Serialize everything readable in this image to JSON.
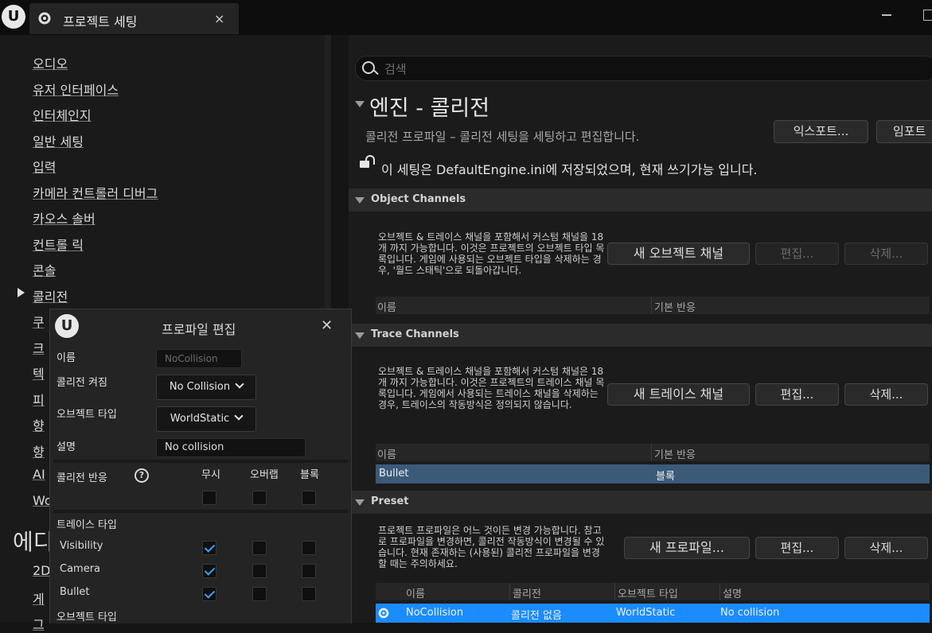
{
  "window": {
    "tab_title": "프로젝트 세팅",
    "close": "×"
  },
  "sidebar": {
    "items": [
      "오디오",
      "유저 인터페이스",
      "인터체인지",
      "일반 세팅",
      "입력",
      "카메라 컨트롤러 디버그",
      "카오스 솔버",
      "컨트롤 릭",
      "콘솔",
      "콜리전",
      "쿠",
      "크",
      "텍",
      "피",
      "향",
      "향",
      "AI",
      "Wo"
    ],
    "section_header": "에디",
    "tail_items": [
      "2D",
      "게",
      "그"
    ]
  },
  "search": {
    "placeholder": "검색"
  },
  "main": {
    "title": "엔진 - 콜리전",
    "description": "콜리전 프로파일 – 콜리전 세팅을 세팅하고 편집합니다.",
    "export_button": "익스포트...",
    "import_button": "임포트",
    "lock_text": "이 세팅은 DefaultEngine.ini에 저장되었으며, 현재 쓰기가능 입니다."
  },
  "object_channels": {
    "header": "Object Channels",
    "desc": "오브젝트 & 트레이스 채널을 포함해서 커스텀 채널을 18 개 까지 가능합니다. 이것은 프로젝트의 오브젝트 타입 목록입니다. 게임에 사용되는 오브젝트 타입을 삭제하는 경우, '월드 스태틱'으로 되돌아갑니다.",
    "new_button": "새 오브젝트 채널",
    "edit_button": "편집...",
    "delete_button": "삭제...",
    "columns": [
      "이름",
      "기본 반응"
    ]
  },
  "trace_channels": {
    "header": "Trace Channels",
    "desc": "오브젝트 & 트레이스 채널을 포함해서 커스텀 채널은 18 개 까지 가능합니다. 이것은 프로젝트의 트레이스 채널 목록입니다. 게임에서 사용되는 트레이스 채널을 삭제하는 경우, 트레이스의 작동방식은 정의되지 않습니다.",
    "new_button": "새 트레이스 채널",
    "edit_button": "편집...",
    "delete_button": "삭제...",
    "columns": [
      "이름",
      "기본 반응"
    ],
    "rows": [
      {
        "name": "Bullet",
        "response": "블록"
      }
    ]
  },
  "preset": {
    "header": "Preset",
    "desc": "프로젝트 프로파일은 어느 것이든 변경 가능합니다. 참고로 프로파일을 변경하면, 콜리전 작동방식이 변경될 수 있습니다. 현재 존재하는 (사용된) 콜리전 프로파일을 변경할 때는 주의하세요.",
    "new_button": "새 프로파일...",
    "edit_button": "편집...",
    "delete_button": "삭제...",
    "columns": [
      "이름",
      "콜리전",
      "오브젝트 타입",
      "설명"
    ],
    "rows": [
      {
        "name": "NoCollision",
        "collision": "콜리전 없음",
        "object_type": "WorldStatic",
        "description": "No collision"
      }
    ]
  },
  "dialog": {
    "title": "프로파일 편집",
    "close": "✕",
    "name_label": "이름",
    "name_value": "NoCollision",
    "collision_enabled_label": "콜리전 켜짐",
    "collision_enabled_value": "No Collision",
    "object_type_label": "오브젝트 타입",
    "object_type_value": "WorldStatic",
    "description_label": "설명",
    "description_value": "No collision",
    "response_label": "콜리전 반응",
    "col_ignore": "무시",
    "col_overlap": "오버랩",
    "col_block": "블록",
    "trace_type_label": "트레이스 타입",
    "trace_rows": [
      {
        "label": "Visibility",
        "ignore": true,
        "overlap": false,
        "block": false
      },
      {
        "label": "Camera",
        "ignore": true,
        "overlap": false,
        "block": false
      },
      {
        "label": "Bullet",
        "ignore": true,
        "overlap": false,
        "block": false
      }
    ],
    "object_type_section": "오브젝트 타입"
  },
  "colors": {
    "accent": "#1a8cff",
    "selected_row": "#3a5a78",
    "check": "#3aa0ff"
  }
}
